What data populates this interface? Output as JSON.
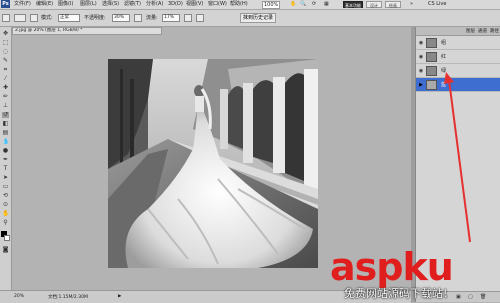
{
  "menubar": {
    "logo": "Ps",
    "items": [
      "文件(F)",
      "编辑(E)",
      "图像(I)",
      "图层(L)",
      "选择(S)",
      "滤镜(T)",
      "分析(A)",
      "3D(D)",
      "视图(V)",
      "窗口(W)",
      "帮助(H)"
    ],
    "zoom": "100%",
    "workspaces": [
      "基本功能",
      "设计",
      "绘画"
    ],
    "cs_live": "CS Live"
  },
  "options": {
    "mode_label": "模式:",
    "mode_value": "正常",
    "opacity_label": "不透明度:",
    "opacity_value": "30%",
    "flow_label": "流量:",
    "flow_value": "17%",
    "auto_erase": "抹到历史记录"
  },
  "document": {
    "tab_title": "2.jpg @ 20% (图层 1, RGB/8) *"
  },
  "status": {
    "zoom": "20%",
    "doc_size": "文档:1.15M/2.30M"
  },
  "layers_panel": {
    "tabs": [
      "图层",
      "通道",
      "路径"
    ],
    "layers": [
      {
        "name": "组",
        "visible": true,
        "selected": false
      },
      {
        "name": "红",
        "visible": true,
        "selected": false
      },
      {
        "name": "绿",
        "visible": true,
        "selected": false
      },
      {
        "name": "蓝",
        "visible": true,
        "selected": true
      }
    ]
  },
  "watermark": {
    "logo": "aspku",
    "tagline": "免费网站源码下载站!"
  },
  "colors": {
    "accent_selected": "#3e6ed0",
    "watermark_red": "#e01e1e",
    "arrow_red": "#e53030"
  }
}
